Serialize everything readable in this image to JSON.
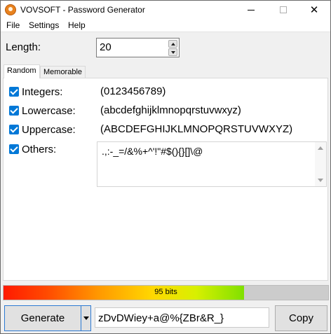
{
  "window": {
    "title": "VOVSOFT - Password Generator",
    "icon": "vovsoft-app-icon",
    "controls": {
      "minimize": "minimize-icon",
      "maximize": "maximize-icon",
      "close": "✕"
    }
  },
  "menu": {
    "file": "File",
    "settings": "Settings",
    "help": "Help"
  },
  "length": {
    "label": "Length:",
    "value": "20"
  },
  "tabs": {
    "random": "Random",
    "memorable": "Memorable",
    "active": "Random"
  },
  "options": [
    {
      "label": "Integers:",
      "chars": "(0123456789)",
      "checked": true
    },
    {
      "label": "Lowercase:",
      "chars": "(abcdefghijklmnopqrstuvwxyz)",
      "checked": true
    },
    {
      "label": "Uppercase:",
      "chars": "(ABCDEFGHIJKLMNOPQRSTUVWXYZ)",
      "checked": true
    },
    {
      "label": "Others:",
      "chars": ".,:-_=/&%+^'!\"#$(){}[]\\@",
      "checked": true
    }
  ],
  "strength": {
    "text": "95 bits",
    "fraction": 0.74
  },
  "actions": {
    "generate": "Generate",
    "copy": "Copy"
  },
  "password": "zDvDWiey+a@%{ZBr&R_}",
  "colors": {
    "accent": "#0078d7",
    "button_border_focus": "#2d7ad3"
  }
}
